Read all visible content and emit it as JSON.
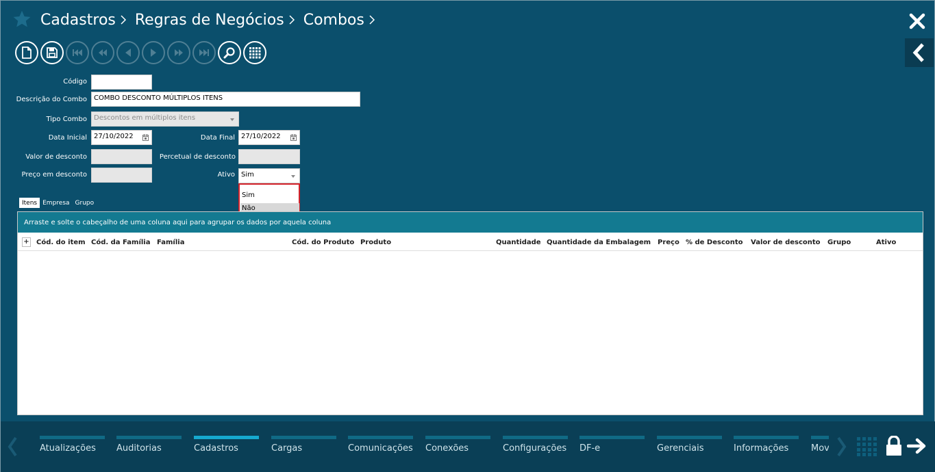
{
  "breadcrumb": [
    "Cadastros",
    "Regras de Negócios",
    "Combos"
  ],
  "form": {
    "codigo": {
      "label": "Código",
      "value": ""
    },
    "descricao": {
      "label": "Descrição do Combo",
      "value": "COMBO DESCONTO MÚLTIPLOS ITENS"
    },
    "tipo": {
      "label": "Tipo Combo",
      "value": "Descontos em múltiplos itens"
    },
    "data_inicial": {
      "label": "Data Inicial",
      "value": "27/10/2022"
    },
    "data_final": {
      "label": "Data Final",
      "value": "27/10/2022"
    },
    "valor_desconto": {
      "label": "Valor de desconto",
      "value": ""
    },
    "percentual_desconto": {
      "label": "Percetual de desconto",
      "value": ""
    },
    "preco_desconto": {
      "label": "Preço em desconto",
      "value": ""
    },
    "ativo": {
      "label": "Ativo",
      "value": "Sim",
      "options": [
        "Sim",
        "Não"
      ]
    }
  },
  "tabs": [
    "Itens",
    "Empresa",
    "Grupo"
  ],
  "grid": {
    "group_hint": "Arraste e solte o cabeçalho de uma coluna aqui para agrupar os dados por aquela coluna",
    "expand": "+",
    "columns": [
      "Cód. do item",
      "Cód. da Família",
      "Família",
      "Cód. do Produto",
      "Produto",
      "Quantidade",
      "Quantidade da Embalagem",
      "Preço",
      "% de Desconto",
      "Valor de desconto",
      "Grupo",
      "Ativo"
    ]
  },
  "bottom_nav": [
    "Atualizações",
    "Auditorias",
    "Cadastros",
    "Cargas",
    "Comunicações",
    "Conexões",
    "Configurações",
    "DF-e",
    "Gerenciais",
    "Informações",
    "Movimentos"
  ],
  "colors": {
    "background": "#0b4f6c",
    "accent": "#16a9cf",
    "group_bar": "#137a91",
    "highlight": "#d4222a"
  }
}
